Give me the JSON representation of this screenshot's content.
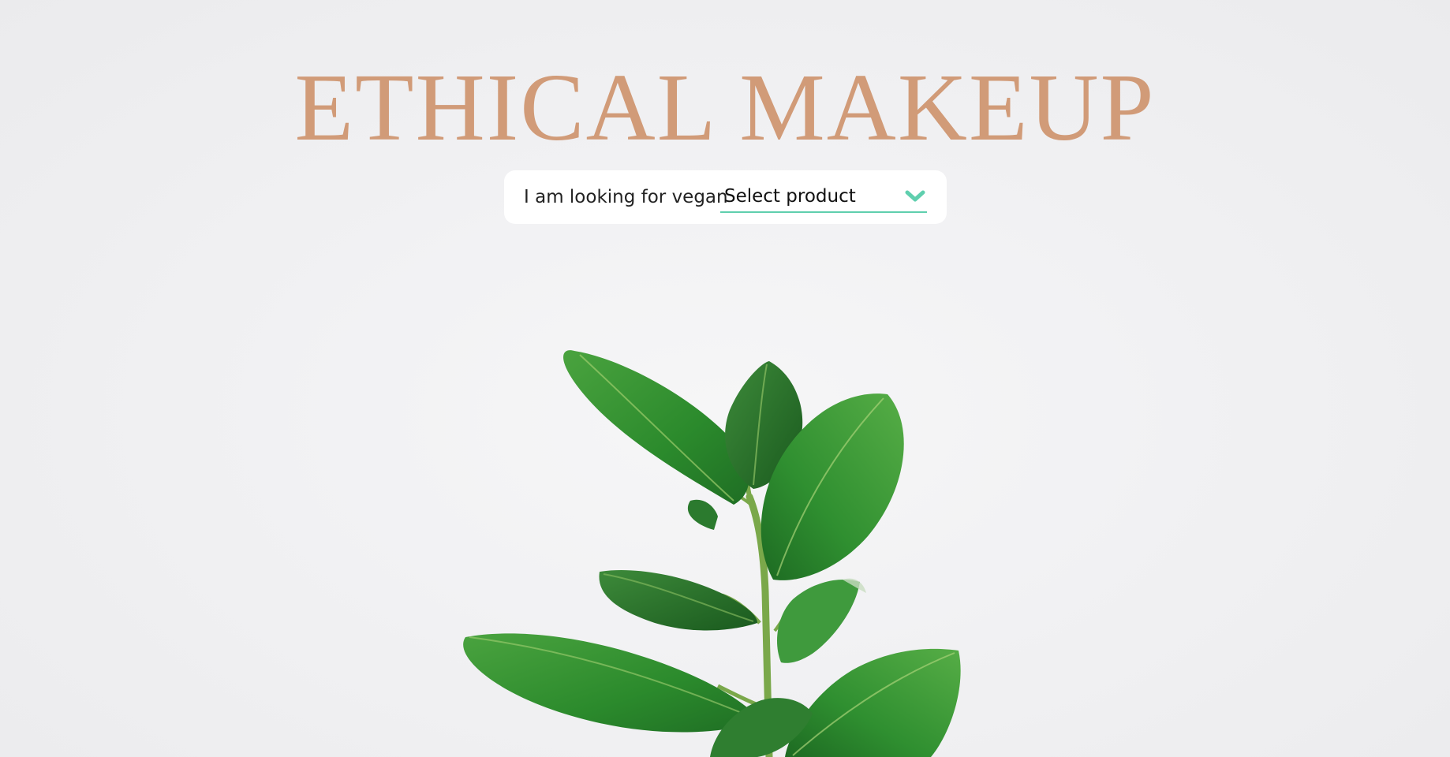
{
  "header": {
    "title": "ETHICAL MAKEUP"
  },
  "search": {
    "label": "I am looking for vegan",
    "selected_product": "Select product",
    "dropdown_icon": "chevron-down-icon"
  },
  "hero": {
    "image": "rubber-plant-leaves"
  },
  "colors": {
    "title": "#d19b78",
    "accent": "#5fcfae",
    "background": "#f2f2f4",
    "leaf": "#2f8a2f"
  }
}
